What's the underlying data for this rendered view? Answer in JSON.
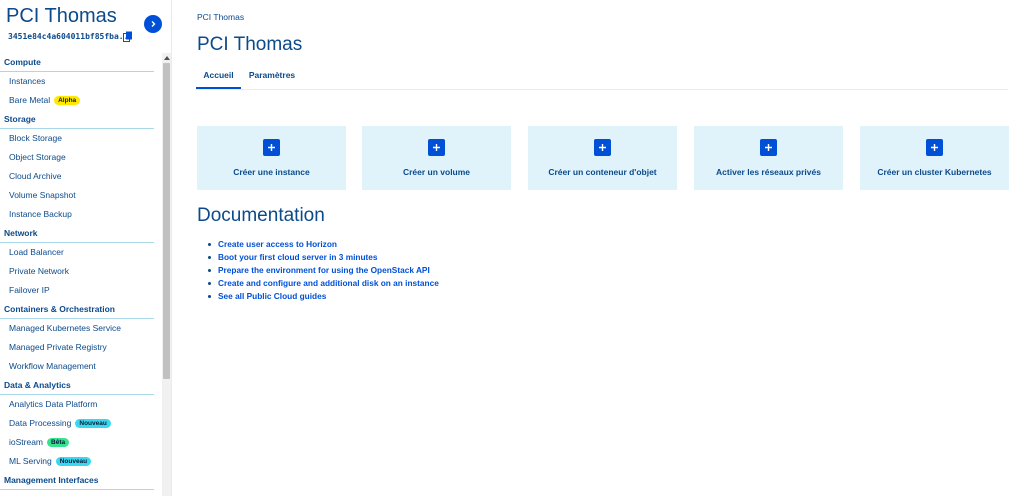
{
  "sidebar": {
    "project_title": "PCI Thomas",
    "project_id": "3451e84c4a604011bf85fba...",
    "sections": [
      {
        "title": "Compute",
        "items": [
          {
            "label": "Instances",
            "badge": null
          },
          {
            "label": "Bare Metal",
            "badge": "Alpha",
            "badge_type": "alpha"
          }
        ]
      },
      {
        "title": "Storage",
        "items": [
          {
            "label": "Block Storage",
            "badge": null
          },
          {
            "label": "Object Storage",
            "badge": null
          },
          {
            "label": "Cloud Archive",
            "badge": null
          },
          {
            "label": "Volume Snapshot",
            "badge": null
          },
          {
            "label": "Instance Backup",
            "badge": null
          }
        ]
      },
      {
        "title": "Network",
        "items": [
          {
            "label": "Load Balancer",
            "badge": null
          },
          {
            "label": "Private Network",
            "badge": null
          },
          {
            "label": "Failover IP",
            "badge": null
          }
        ]
      },
      {
        "title": "Containers & Orchestration",
        "items": [
          {
            "label": "Managed Kubernetes Service",
            "badge": null
          },
          {
            "label": "Managed Private Registry",
            "badge": null
          },
          {
            "label": "Workflow Management",
            "badge": null
          }
        ]
      },
      {
        "title": "Data & Analytics",
        "items": [
          {
            "label": "Analytics Data Platform",
            "badge": null
          },
          {
            "label": "Data Processing",
            "badge": "Nouveau",
            "badge_type": "nouveau"
          },
          {
            "label": "ioStream",
            "badge": "Bêta",
            "badge_type": "beta"
          },
          {
            "label": "ML Serving",
            "badge": "Nouveau",
            "badge_type": "nouveau"
          }
        ]
      },
      {
        "title": "Management Interfaces",
        "items": []
      }
    ]
  },
  "main": {
    "breadcrumb": "PCI Thomas",
    "title": "PCI Thomas",
    "tabs": [
      {
        "label": "Accueil",
        "active": true
      },
      {
        "label": "Paramètres",
        "active": false
      }
    ],
    "actions": [
      {
        "label": "Créer une instance",
        "icon": "plus-icon"
      },
      {
        "label": "Créer un volume",
        "icon": "plus-icon"
      },
      {
        "label": "Créer un conteneur d'objet",
        "icon": "plus-icon"
      },
      {
        "label": "Activer les réseaux privés",
        "icon": "plus-icon"
      },
      {
        "label": "Créer un cluster Kubernetes",
        "icon": "plus-icon"
      }
    ],
    "documentation": {
      "title": "Documentation",
      "links": [
        "Create user access to Horizon",
        "Boot your first cloud server in 3 minutes",
        "Prepare the environment for using the OpenStack API",
        "Create and configure and additional disk on an instance",
        "See all Public Cloud guides"
      ]
    }
  },
  "colors": {
    "primary": "#0050d7",
    "text": "#0b4a8b",
    "tile_bg": "#e0f3fb",
    "badge_alpha": "#ffe900",
    "badge_nouveau": "#3ad8ef",
    "badge_beta": "#37e28e"
  }
}
